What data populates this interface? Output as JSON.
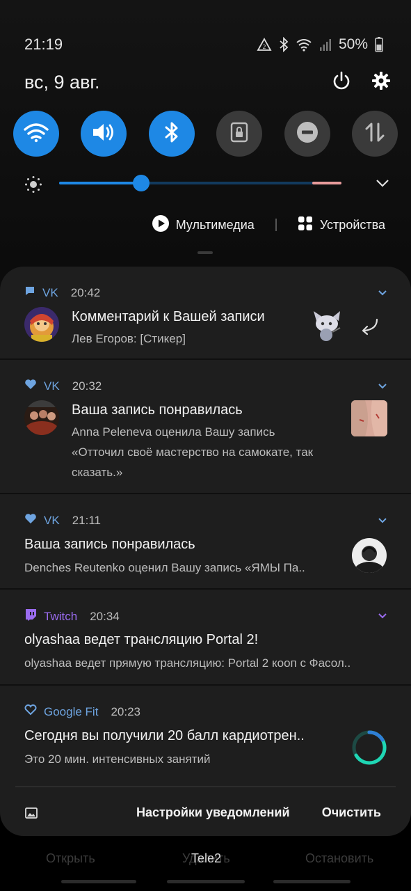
{
  "status_bar": {
    "time": "21:19",
    "battery": "50%"
  },
  "header": {
    "date": "вс, 9 авг."
  },
  "quick_toggles": [
    {
      "name": "wifi",
      "state": "on"
    },
    {
      "name": "sound",
      "state": "on"
    },
    {
      "name": "bluetooth",
      "state": "on"
    },
    {
      "name": "screen-lock",
      "state": "off"
    },
    {
      "name": "do-not-disturb",
      "state": "off"
    },
    {
      "name": "mobile-data",
      "state": "off"
    }
  ],
  "brightness": {
    "level_fraction": 0.29
  },
  "media": {
    "multimedia_label": "Мультимедиа",
    "devices_label": "Устройства"
  },
  "colors": {
    "accent": "#1e88e5",
    "vk": "#6ea4e0",
    "twitch": "#9b6cf0",
    "panel": "#1e1e1e"
  },
  "notifications": [
    {
      "app": "VK",
      "time": "20:42",
      "app_icon": "message-icon",
      "title": "Комментарий к Вашей записи",
      "body": [
        "Лев Егоров: [Стикер]"
      ]
    },
    {
      "app": "VK",
      "time": "20:32",
      "app_icon": "heart-icon",
      "title": "Ваша запись понравилась",
      "body": [
        "Anna Peleneva оценила Вашу запись",
        "«Отточил своё мастерство на самокате, так",
        "сказать.»"
      ]
    },
    {
      "app": "VK",
      "time": "21:11",
      "app_icon": "heart-icon",
      "title": "Ваша запись понравилась",
      "body": [
        "Denches Reutenko оценил Вашу запись «ЯМЫ Па.."
      ]
    },
    {
      "app": "Twitch",
      "time": "20:34",
      "app_icon": "twitch-icon",
      "title": "olyashaa ведет трансляцию Portal 2!",
      "body": [
        "olyashaa ведет прямую трансляцию: Portal 2 кооп с Фасол.."
      ]
    },
    {
      "app": "Google Fit",
      "time": "20:23",
      "app_icon": "google-fit-icon",
      "title": "Сегодня вы получили 20 балл кардиотрен..",
      "body": [
        "Это 20 мин. интенсивных занятий"
      ]
    }
  ],
  "footer": {
    "settings_label": "Настройки уведомлений",
    "clear_label": "Очистить"
  },
  "behind": {
    "open_label": "Открыть",
    "delete_label": "Удалить",
    "stop_label": "Остановить",
    "carrier": "Tele2"
  }
}
